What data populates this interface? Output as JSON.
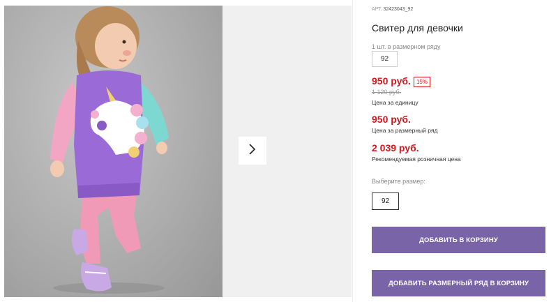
{
  "product": {
    "sku_prefix": "АРТ.",
    "sku": "32423043_92",
    "title": "Свитер для девочки",
    "row_label": "1 шт. в размерном ряду",
    "row_size": "92",
    "price": "950 руб.",
    "discount": "15%",
    "old_price": "1 120 руб.",
    "price_caption": "Цена за единицу",
    "row_price": "950 руб.",
    "row_price_caption": "Цена за размерный ряд",
    "retail_price": "2 039 руб.",
    "retail_price_caption": "Рекомендуемая розничная цена",
    "choose_size_label": "Выберите размер:",
    "selected_size": "92"
  },
  "actions": {
    "add_to_cart": "ДОБАВИТЬ В КОРЗИНУ",
    "add_row_to_cart": "ДОБАВИТЬ РАЗМЕРНЫЙ РЯД В КОРЗИНУ"
  },
  "colors": {
    "accent": "#7a64a8",
    "price_red": "#d6161c"
  },
  "icons": {
    "next": "chevron-right-icon"
  }
}
